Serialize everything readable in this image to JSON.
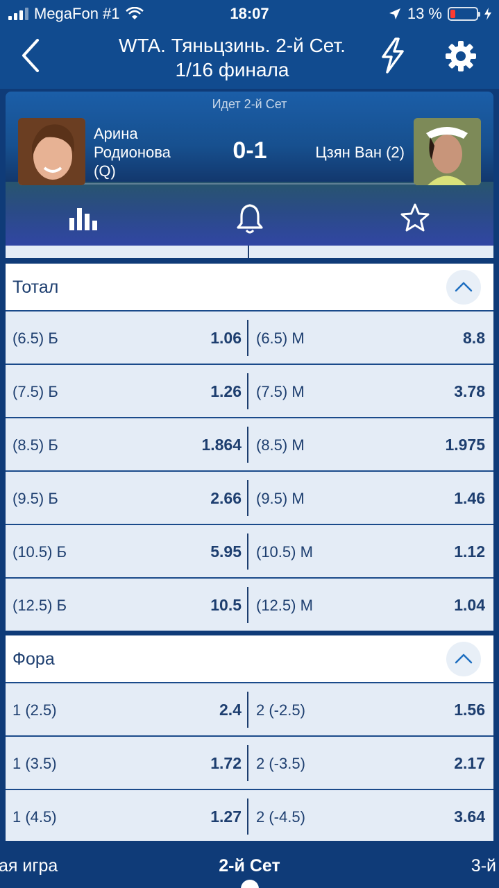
{
  "status": {
    "carrier": "MegaFon #1",
    "time": "18:07",
    "battery": "13 %"
  },
  "header": {
    "title_line1": "WTA. Тяньцзинь. 2-й Сет.",
    "title_line2": "1/16 финала"
  },
  "match": {
    "live_label": "Идет 2-й Сет",
    "player_left_line1": "Арина",
    "player_left_line2": "Родионова",
    "player_left_line3": "(Q)",
    "player_right": "Цзян Ван (2)",
    "score": "0-1"
  },
  "markets": {
    "total": {
      "title": "Тотал",
      "rows": [
        {
          "left_label": "(6.5) Б",
          "left_odd": "1.06",
          "right_label": "(6.5) М",
          "right_odd": "8.8"
        },
        {
          "left_label": "(7.5) Б",
          "left_odd": "1.26",
          "right_label": "(7.5) М",
          "right_odd": "3.78"
        },
        {
          "left_label": "(8.5) Б",
          "left_odd": "1.864",
          "right_label": "(8.5) М",
          "right_odd": "1.975"
        },
        {
          "left_label": "(9.5) Б",
          "left_odd": "2.66",
          "right_label": "(9.5) М",
          "right_odd": "1.46"
        },
        {
          "left_label": "(10.5) Б",
          "left_odd": "5.95",
          "right_label": "(10.5) М",
          "right_odd": "1.12"
        },
        {
          "left_label": "(12.5) Б",
          "left_odd": "10.5",
          "right_label": "(12.5) М",
          "right_odd": "1.04"
        }
      ]
    },
    "handicap": {
      "title": "Фора",
      "rows": [
        {
          "left_label": "1 (2.5)",
          "left_odd": "2.4",
          "right_label": "2 (-2.5)",
          "right_odd": "1.56"
        },
        {
          "left_label": "1 (3.5)",
          "left_odd": "1.72",
          "right_label": "2 (-3.5)",
          "right_odd": "2.17"
        },
        {
          "left_label": "1 (4.5)",
          "left_odd": "1.27",
          "right_label": "2 (-4.5)",
          "right_odd": "3.64"
        }
      ]
    }
  },
  "tabs": {
    "left": "ая игра",
    "center": "2-й Сет",
    "right": "3-й"
  },
  "colors": {
    "header_bg": "#114b8f",
    "odds_text": "#1d3e6f",
    "row_bg": "#e4ecf6",
    "battery_low": "#ff3b30"
  }
}
